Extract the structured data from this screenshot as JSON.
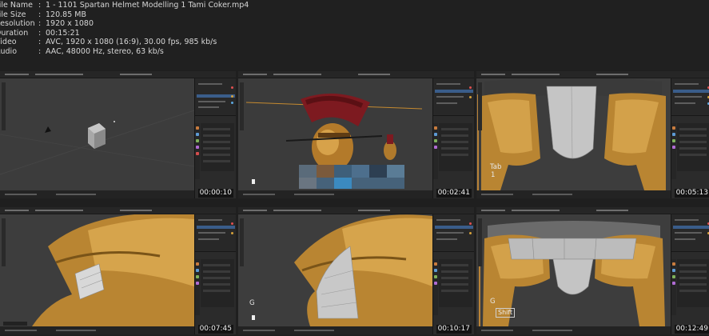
{
  "file_info": {
    "rows": [
      {
        "key": "File Name",
        "value": "1 - 1101 Spartan Helmet Modelling 1 Tami Coker.mp4"
      },
      {
        "key": "File Size",
        "value": "120.85 MB"
      },
      {
        "key": "Resolution",
        "value": "1920 x 1080"
      },
      {
        "key": "Duration",
        "value": "00:15:21"
      },
      {
        "key": "Video",
        "value": "AVC, 1920 x 1080 (16:9), 30.00 fps, 985 kb/s"
      },
      {
        "key": "Audio",
        "value": "AAC, 48000 Hz, stereo, 63 kb/s"
      }
    ],
    "separator": ":"
  },
  "thumbnails": [
    {
      "timestamp": "00:00:10",
      "scene": "empty-viewport-cube"
    },
    {
      "timestamp": "00:02:41",
      "scene": "helmet-with-crest-reference"
    },
    {
      "timestamp": "00:05:13",
      "scene": "helmet-front-closeup",
      "key_label": "Tab",
      "key_sub": "1"
    },
    {
      "timestamp": "00:07:45",
      "scene": "helmet-side-cheek"
    },
    {
      "timestamp": "00:10:17",
      "scene": "helmet-side-mesh",
      "key_label": "G"
    },
    {
      "timestamp": "00:12:49",
      "scene": "helmet-front-mesh",
      "key_label": "G",
      "key_sub": "Shift"
    }
  ],
  "colors": {
    "background": "#1f1f1f",
    "text": "#d6d6d6",
    "gold": "#c8892c",
    "crest": "#8c1d22",
    "selection": "#3a5d8a"
  }
}
